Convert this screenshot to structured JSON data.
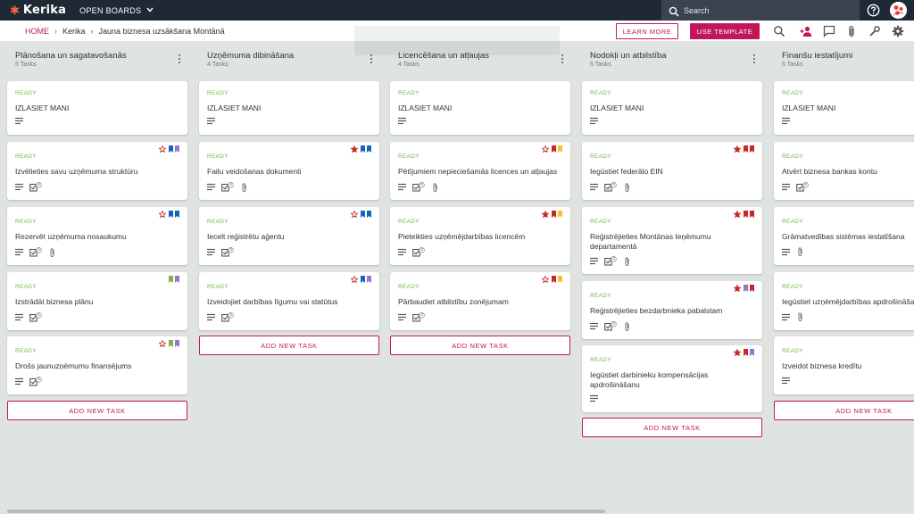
{
  "app": {
    "logo_text": "Kerika",
    "open_boards": "OPEN BOARDS",
    "search_placeholder": "Search"
  },
  "breadcrumb": {
    "home": "HOME",
    "project": "Kerika",
    "board": "Jauna biznesa uzsākšana Montānā"
  },
  "actions": {
    "learn_more": "LEARN MORE",
    "use_template": "USE TEMPLATE"
  },
  "colors": {
    "accent": "#c2185b",
    "ready": "#7cb342",
    "blue": "#1565c0",
    "purple": "#9575cd",
    "green": "#7cb342",
    "red": "#c62828",
    "yellow": "#fbc02d",
    "topbar": "#1f2835"
  },
  "add_task_label": "ADD NEW TASK",
  "columns": [
    {
      "title": "Plānošana un sagatavošanās",
      "count": "5 Tasks",
      "cards": [
        {
          "status": "READY",
          "title": "IZLASIET MANI",
          "checklist": "",
          "attach": false,
          "star": "",
          "flags": []
        },
        {
          "status": "READY",
          "title": "Izvēlieties savu uzņēmuma struktūru",
          "checklist": "4",
          "attach": false,
          "star": "outline",
          "flags": [
            "blue",
            "purple"
          ]
        },
        {
          "status": "READY",
          "title": "Rezervēt uzņēmuma nosaukumu",
          "checklist": "4",
          "attach": true,
          "star": "outline",
          "flags": [
            "blue",
            "blue"
          ]
        },
        {
          "status": "READY",
          "title": "Izstrādāt biznesa plānu",
          "checklist": "4",
          "attach": false,
          "star": "",
          "flags": [
            "green",
            "purple"
          ]
        },
        {
          "status": "READY",
          "title": "Drošs jaunuzņēmumu finansējums",
          "checklist": "4",
          "attach": false,
          "star": "outline",
          "flags": [
            "green",
            "purple"
          ]
        }
      ]
    },
    {
      "title": "Uzņēmuma dibināšana",
      "count": "4 Tasks",
      "cards": [
        {
          "status": "READY",
          "title": "IZLASIET MANI",
          "checklist": "",
          "attach": false,
          "star": "",
          "flags": []
        },
        {
          "status": "READY",
          "title": "Failu veidošanas dokumenti",
          "checklist": "4",
          "attach": true,
          "star": "filled",
          "flags": [
            "blue",
            "blue"
          ]
        },
        {
          "status": "READY",
          "title": "Iecelt reģistrētu aģentu",
          "checklist": "3",
          "attach": false,
          "star": "outline",
          "flags": [
            "blue",
            "blue"
          ]
        },
        {
          "status": "READY",
          "title": "Izveidojiet darbības līgumu vai statūtus",
          "checklist": "3",
          "attach": false,
          "star": "outline",
          "flags": [
            "blue",
            "purple"
          ]
        }
      ]
    },
    {
      "title": "Licencēšana un atļaujas",
      "count": "4 Tasks",
      "cards": [
        {
          "status": "READY",
          "title": "IZLASIET MANI",
          "checklist": "",
          "attach": false,
          "star": "",
          "flags": []
        },
        {
          "status": "READY",
          "title": "Pētījumiem nepieciešamās licences un atļaujas",
          "checklist": "3",
          "attach": true,
          "star": "outline",
          "flags": [
            "red",
            "yellow"
          ]
        },
        {
          "status": "READY",
          "title": "Pieteikties uzņēmējdarbības licencēm",
          "checklist": "3",
          "attach": false,
          "star": "filled",
          "flags": [
            "red",
            "yellow"
          ]
        },
        {
          "status": "READY",
          "title": "Pārbaudiet atbilstību zonējumam",
          "checklist": "3",
          "attach": false,
          "star": "outline",
          "flags": [
            "red",
            "yellow"
          ]
        }
      ]
    },
    {
      "title": "Nodokļi un atbilstība",
      "count": "5 Tasks",
      "cards": [
        {
          "status": "READY",
          "title": "IZLASIET MANI",
          "checklist": "",
          "attach": false,
          "star": "",
          "flags": []
        },
        {
          "status": "READY",
          "title": "Iegūstiet federālo EIN",
          "checklist": "3",
          "attach": true,
          "star": "filled",
          "flags": [
            "red",
            "red"
          ]
        },
        {
          "status": "READY",
          "title": "Reģistrējieties Montānas Ieņēmumu departamentā",
          "checklist": "3",
          "attach": true,
          "star": "filled",
          "flags": [
            "red",
            "red"
          ]
        },
        {
          "status": "READY",
          "title": "Reģistrējieties bezdarbnieka pabalstam",
          "checklist": "3",
          "attach": true,
          "star": "filled",
          "flags": [
            "purple",
            "red"
          ]
        },
        {
          "status": "READY",
          "title": "Iegūstiet darbinieku kompensācijas apdrošināšanu",
          "checklist": "",
          "attach": false,
          "star": "filled",
          "flags": [
            "red",
            "purple"
          ]
        }
      ]
    },
    {
      "title": "Finanšu iestatījumi",
      "count": "5 Tasks",
      "cards": [
        {
          "status": "READY",
          "title": "IZLASIET MANI",
          "checklist": "",
          "attach": false,
          "star": "",
          "flags": []
        },
        {
          "status": "READY",
          "title": "Atvērt biznesa bankas kontu",
          "checklist": "4",
          "attach": false,
          "star": "",
          "flags": []
        },
        {
          "status": "READY",
          "title": "Grāmatvedības sistēmas iestatīšana",
          "checklist": "",
          "attach": true,
          "star": "",
          "flags": []
        },
        {
          "status": "READY",
          "title": "Iegūstiet uzņēmējdarbības apdrošināšan",
          "checklist": "",
          "attach": true,
          "star": "",
          "flags": []
        },
        {
          "status": "READY",
          "title": "Izveidot biznesa kredītu",
          "checklist": "",
          "attach": false,
          "star": "",
          "flags": []
        }
      ]
    }
  ]
}
